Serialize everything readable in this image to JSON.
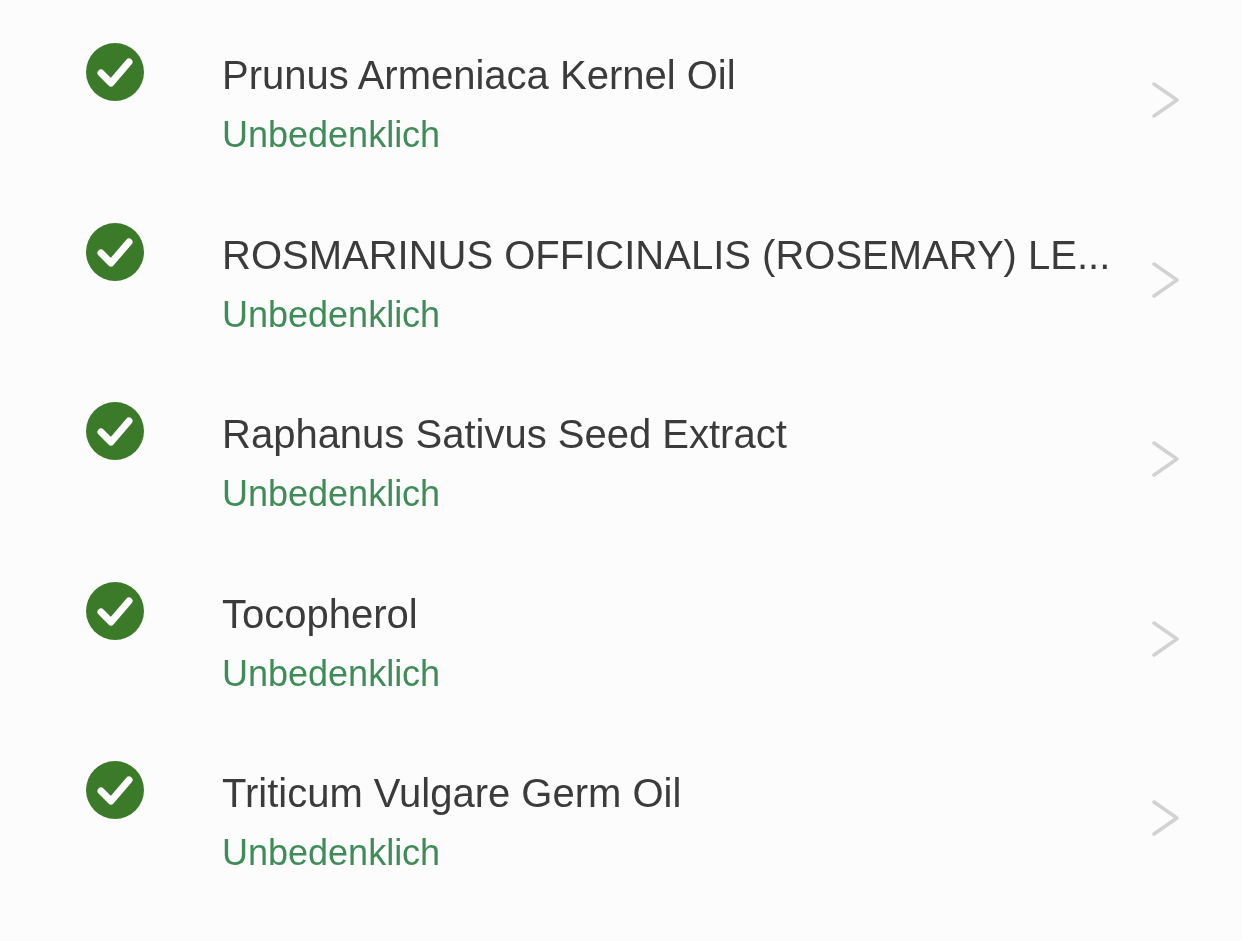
{
  "ingredients": [
    {
      "name": "Prunus Armeniaca Kernel Oil",
      "rating": "Unbedenklich"
    },
    {
      "name": "ROSMARINUS OFFICINALIS (ROSEMARY) LE...",
      "rating": "Unbedenklich"
    },
    {
      "name": "Raphanus Sativus Seed Extract",
      "rating": "Unbedenklich"
    },
    {
      "name": "Tocopherol",
      "rating": "Unbedenklich"
    },
    {
      "name": "Triticum Vulgare Germ Oil",
      "rating": "Unbedenklich"
    }
  ]
}
